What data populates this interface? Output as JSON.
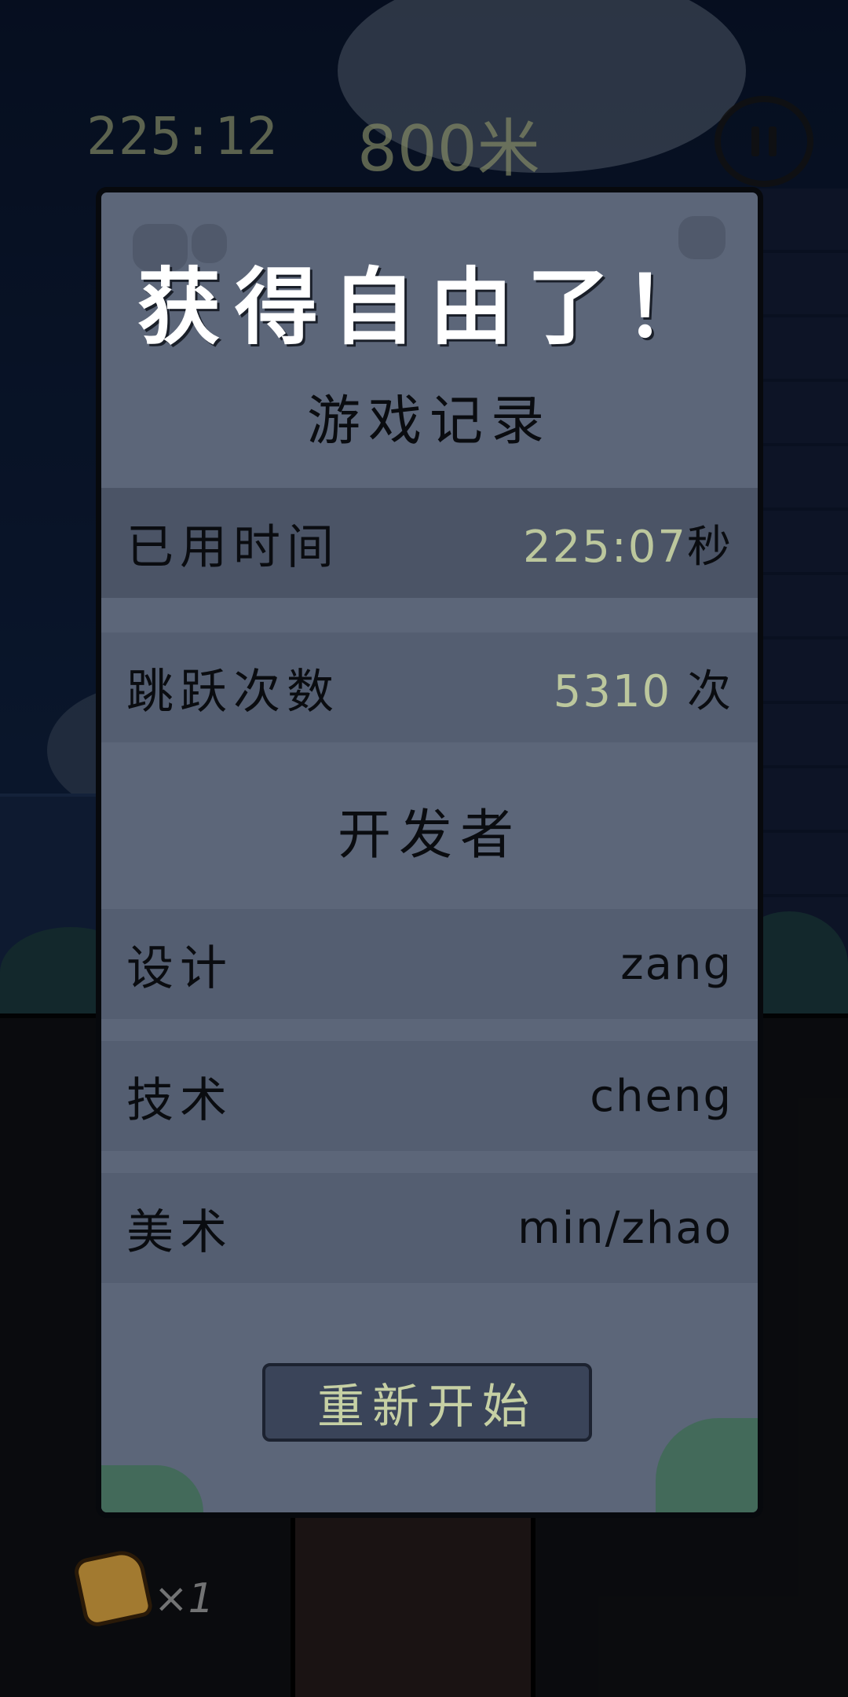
{
  "hud": {
    "timer": "225:12",
    "distance": "800米"
  },
  "modal": {
    "title": "获得自由了！",
    "record_heading": "游戏记录",
    "stats": [
      {
        "label": "已用时间",
        "value": "225:07",
        "unit": "秒"
      },
      {
        "label": "跳跃次数",
        "value": "5310",
        "unit": "次"
      }
    ],
    "developers_heading": "开发者",
    "developers": [
      {
        "role": "设计",
        "name": "zang"
      },
      {
        "role": "技术",
        "name": "cheng"
      },
      {
        "role": "美术",
        "name": "min/zhao"
      }
    ],
    "restart_label": "重新开始"
  },
  "inventory": {
    "count": "×1"
  },
  "icons": {
    "pause": "pause-icon",
    "item": "item-icon"
  }
}
